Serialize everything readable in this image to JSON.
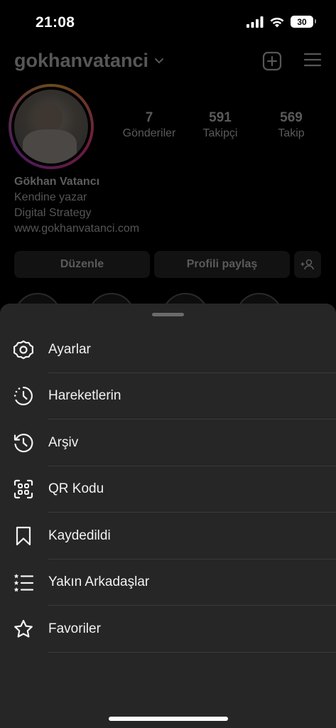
{
  "status": {
    "time": "21:08",
    "battery": "30"
  },
  "profile": {
    "username": "gokhanvatanci",
    "stats": [
      {
        "value": "7",
        "label": "Gönderiler"
      },
      {
        "value": "591",
        "label": "Takipçi"
      },
      {
        "value": "569",
        "label": "Takip"
      }
    ],
    "bio": {
      "name": "Gökhan Vatancı",
      "line1": "Kendine yazar",
      "line2": "Digital Strategy",
      "link": "www.gokhanvatanci.com"
    },
    "buttons": {
      "edit": "Düzenle",
      "share": "Profili paylaş"
    }
  },
  "menu": {
    "items": [
      {
        "label": "Ayarlar",
        "icon": "settings-gear-icon"
      },
      {
        "label": "Hareketlerin",
        "icon": "activity-clock-icon"
      },
      {
        "label": "Arşiv",
        "icon": "archive-history-icon"
      },
      {
        "label": "QR Kodu",
        "icon": "qr-code-icon"
      },
      {
        "label": "Kaydedildi",
        "icon": "bookmark-icon"
      },
      {
        "label": "Yakın Arkadaşlar",
        "icon": "close-friends-list-icon"
      },
      {
        "label": "Favoriler",
        "icon": "star-icon"
      }
    ]
  }
}
